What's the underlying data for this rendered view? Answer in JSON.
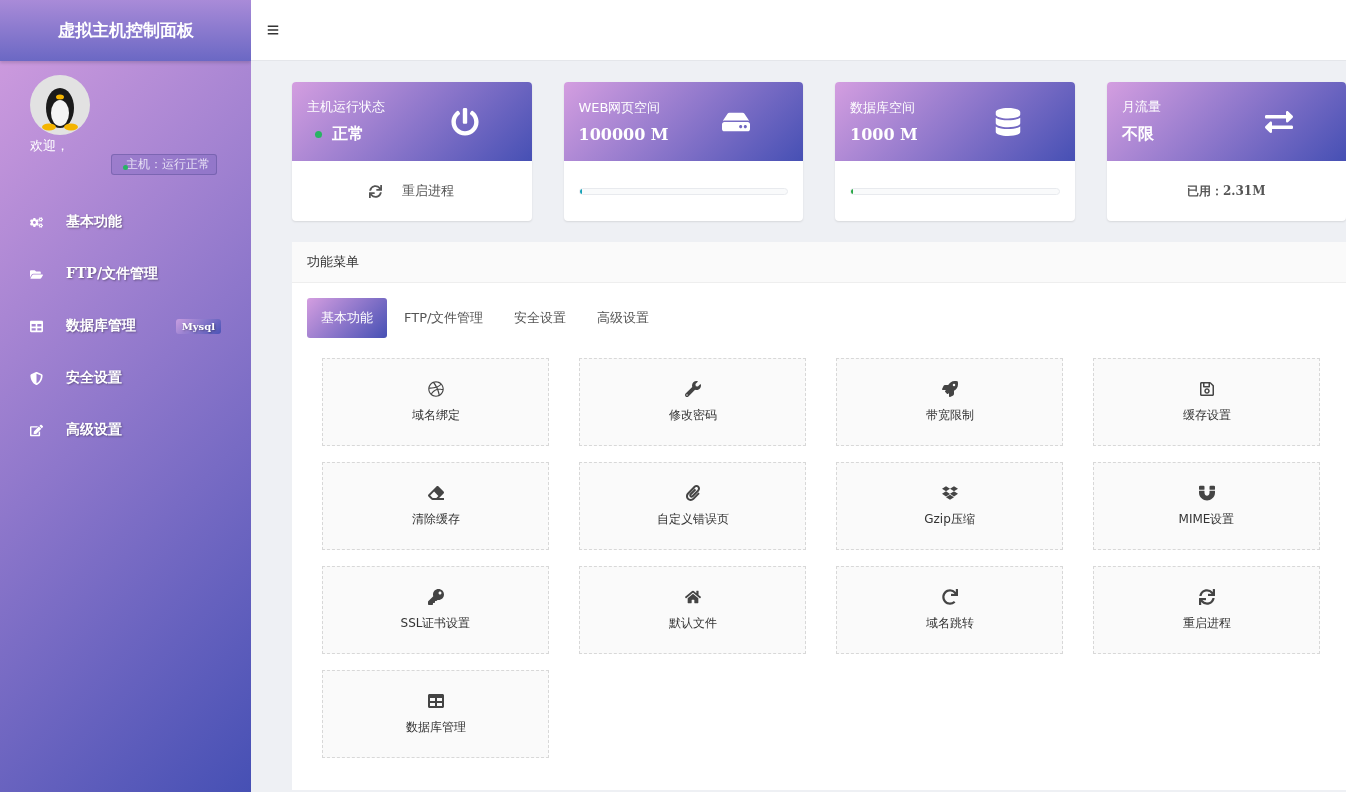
{
  "sidebar": {
    "title": "虚拟主机控制面板",
    "welcome": "欢迎，",
    "status_badge": "主机：运行正常",
    "items": [
      {
        "label": "基本功能"
      },
      {
        "label": "FTP/文件管理"
      },
      {
        "label": "数据库管理",
        "badge": "Mysql"
      },
      {
        "label": "安全设置"
      },
      {
        "label": "高级设置"
      }
    ]
  },
  "stats": [
    {
      "kind": "action",
      "title": "主机运行状态",
      "value": "正常",
      "color": "#28b463",
      "footer": "重启进程"
    },
    {
      "kind": "progress",
      "title": "WEB网页空间",
      "value": "100000 M",
      "level": 0.01,
      "color": "#17a2b8"
    },
    {
      "kind": "progress",
      "title": "数据库空间",
      "value": "1000 M",
      "level": 0.01,
      "color": "#28a745"
    },
    {
      "kind": "text",
      "title": "月流量",
      "value": "不限",
      "footer": "已用：2.31M"
    }
  ],
  "panel": {
    "title": "功能菜单",
    "tabs": [
      {
        "label": "基本功能",
        "selected": true
      },
      {
        "label": "FTP/文件管理",
        "selected": false
      },
      {
        "label": "安全设置",
        "selected": false
      },
      {
        "label": "高级设置",
        "selected": false
      }
    ],
    "tiles": [
      {
        "label": "域名绑定"
      },
      {
        "label": "修改密码"
      },
      {
        "label": "带宽限制"
      },
      {
        "label": "缓存设置"
      },
      {
        "label": "清除缓存"
      },
      {
        "label": "自定义错误页"
      },
      {
        "label": "Gzip压缩"
      },
      {
        "label": "MIME设置"
      },
      {
        "label": "SSL证书设置"
      },
      {
        "label": "默认文件"
      },
      {
        "label": "域名跳转"
      },
      {
        "label": "重启进程"
      },
      {
        "label": "数据库管理"
      }
    ]
  }
}
